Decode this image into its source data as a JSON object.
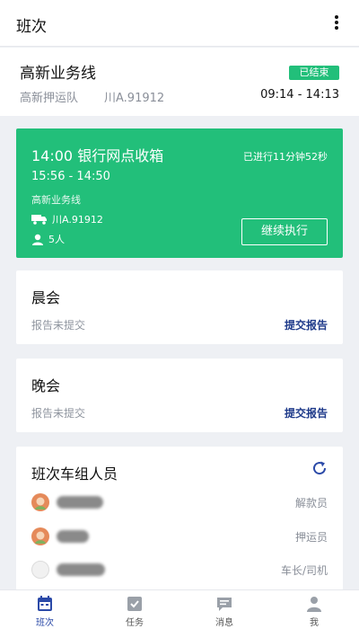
{
  "header": {
    "title": "班次"
  },
  "shift": {
    "line_name": "高新业务线",
    "badge": "已结束",
    "team": "高新押运队",
    "plate": "川A.91912",
    "time_range": "09:14 - 14:13"
  },
  "task": {
    "title": "14:00 银行网点收箱",
    "elapsed": "已进行11分钟52秒",
    "time_range": "15:56 - 14:50",
    "line_name": "高新业务线",
    "plate": "川A.91912",
    "people": "5人",
    "action_label": "继续执行"
  },
  "morning_meeting": {
    "title": "晨会",
    "status": "报告未提交",
    "action_label": "提交报告"
  },
  "evening_meeting": {
    "title": "晚会",
    "status": "报告未提交",
    "action_label": "提交报告"
  },
  "crew": {
    "title": "班次车组人员",
    "members": [
      {
        "role": "解款员"
      },
      {
        "role": "押运员"
      },
      {
        "role": "车长/司机"
      }
    ]
  },
  "tabs": [
    {
      "label": "班次",
      "icon": "calendar-icon"
    },
    {
      "label": "任务",
      "icon": "check-box-icon"
    },
    {
      "label": "消息",
      "icon": "chat-icon"
    },
    {
      "label": "我",
      "icon": "user-icon"
    }
  ],
  "colors": {
    "accent_green": "#22bf7a",
    "link_blue": "#1e3a8a",
    "tab_active": "#2b4aa8"
  }
}
